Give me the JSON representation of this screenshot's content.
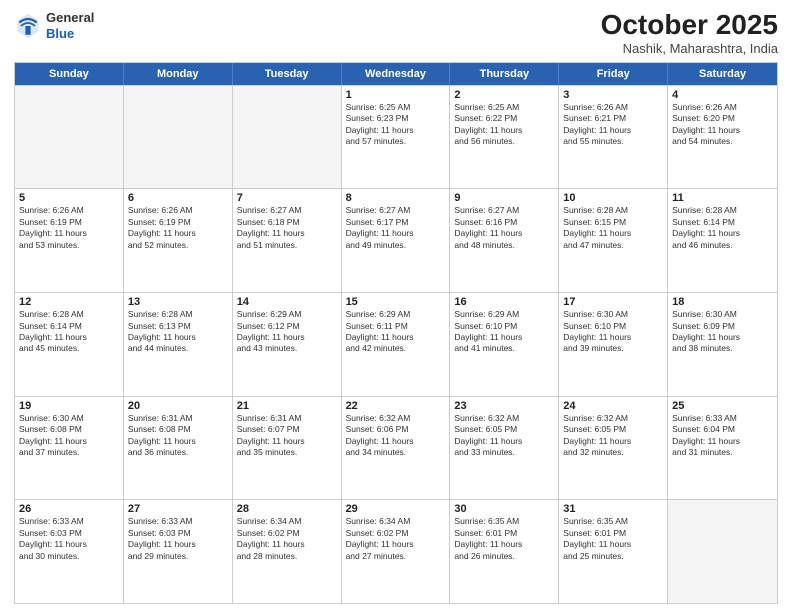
{
  "header": {
    "logo_line1": "General",
    "logo_line2": "Blue",
    "month_title": "October 2025",
    "location": "Nashik, Maharashtra, India"
  },
  "weekdays": [
    "Sunday",
    "Monday",
    "Tuesday",
    "Wednesday",
    "Thursday",
    "Friday",
    "Saturday"
  ],
  "rows": [
    [
      {
        "day": "",
        "info": ""
      },
      {
        "day": "",
        "info": ""
      },
      {
        "day": "",
        "info": ""
      },
      {
        "day": "1",
        "info": "Sunrise: 6:25 AM\nSunset: 6:23 PM\nDaylight: 11 hours\nand 57 minutes."
      },
      {
        "day": "2",
        "info": "Sunrise: 6:25 AM\nSunset: 6:22 PM\nDaylight: 11 hours\nand 56 minutes."
      },
      {
        "day": "3",
        "info": "Sunrise: 6:26 AM\nSunset: 6:21 PM\nDaylight: 11 hours\nand 55 minutes."
      },
      {
        "day": "4",
        "info": "Sunrise: 6:26 AM\nSunset: 6:20 PM\nDaylight: 11 hours\nand 54 minutes."
      }
    ],
    [
      {
        "day": "5",
        "info": "Sunrise: 6:26 AM\nSunset: 6:19 PM\nDaylight: 11 hours\nand 53 minutes."
      },
      {
        "day": "6",
        "info": "Sunrise: 6:26 AM\nSunset: 6:19 PM\nDaylight: 11 hours\nand 52 minutes."
      },
      {
        "day": "7",
        "info": "Sunrise: 6:27 AM\nSunset: 6:18 PM\nDaylight: 11 hours\nand 51 minutes."
      },
      {
        "day": "8",
        "info": "Sunrise: 6:27 AM\nSunset: 6:17 PM\nDaylight: 11 hours\nand 49 minutes."
      },
      {
        "day": "9",
        "info": "Sunrise: 6:27 AM\nSunset: 6:16 PM\nDaylight: 11 hours\nand 48 minutes."
      },
      {
        "day": "10",
        "info": "Sunrise: 6:28 AM\nSunset: 6:15 PM\nDaylight: 11 hours\nand 47 minutes."
      },
      {
        "day": "11",
        "info": "Sunrise: 6:28 AM\nSunset: 6:14 PM\nDaylight: 11 hours\nand 46 minutes."
      }
    ],
    [
      {
        "day": "12",
        "info": "Sunrise: 6:28 AM\nSunset: 6:14 PM\nDaylight: 11 hours\nand 45 minutes."
      },
      {
        "day": "13",
        "info": "Sunrise: 6:28 AM\nSunset: 6:13 PM\nDaylight: 11 hours\nand 44 minutes."
      },
      {
        "day": "14",
        "info": "Sunrise: 6:29 AM\nSunset: 6:12 PM\nDaylight: 11 hours\nand 43 minutes."
      },
      {
        "day": "15",
        "info": "Sunrise: 6:29 AM\nSunset: 6:11 PM\nDaylight: 11 hours\nand 42 minutes."
      },
      {
        "day": "16",
        "info": "Sunrise: 6:29 AM\nSunset: 6:10 PM\nDaylight: 11 hours\nand 41 minutes."
      },
      {
        "day": "17",
        "info": "Sunrise: 6:30 AM\nSunset: 6:10 PM\nDaylight: 11 hours\nand 39 minutes."
      },
      {
        "day": "18",
        "info": "Sunrise: 6:30 AM\nSunset: 6:09 PM\nDaylight: 11 hours\nand 38 minutes."
      }
    ],
    [
      {
        "day": "19",
        "info": "Sunrise: 6:30 AM\nSunset: 6:08 PM\nDaylight: 11 hours\nand 37 minutes."
      },
      {
        "day": "20",
        "info": "Sunrise: 6:31 AM\nSunset: 6:08 PM\nDaylight: 11 hours\nand 36 minutes."
      },
      {
        "day": "21",
        "info": "Sunrise: 6:31 AM\nSunset: 6:07 PM\nDaylight: 11 hours\nand 35 minutes."
      },
      {
        "day": "22",
        "info": "Sunrise: 6:32 AM\nSunset: 6:06 PM\nDaylight: 11 hours\nand 34 minutes."
      },
      {
        "day": "23",
        "info": "Sunrise: 6:32 AM\nSunset: 6:05 PM\nDaylight: 11 hours\nand 33 minutes."
      },
      {
        "day": "24",
        "info": "Sunrise: 6:32 AM\nSunset: 6:05 PM\nDaylight: 11 hours\nand 32 minutes."
      },
      {
        "day": "25",
        "info": "Sunrise: 6:33 AM\nSunset: 6:04 PM\nDaylight: 11 hours\nand 31 minutes."
      }
    ],
    [
      {
        "day": "26",
        "info": "Sunrise: 6:33 AM\nSunset: 6:03 PM\nDaylight: 11 hours\nand 30 minutes."
      },
      {
        "day": "27",
        "info": "Sunrise: 6:33 AM\nSunset: 6:03 PM\nDaylight: 11 hours\nand 29 minutes."
      },
      {
        "day": "28",
        "info": "Sunrise: 6:34 AM\nSunset: 6:02 PM\nDaylight: 11 hours\nand 28 minutes."
      },
      {
        "day": "29",
        "info": "Sunrise: 6:34 AM\nSunset: 6:02 PM\nDaylight: 11 hours\nand 27 minutes."
      },
      {
        "day": "30",
        "info": "Sunrise: 6:35 AM\nSunset: 6:01 PM\nDaylight: 11 hours\nand 26 minutes."
      },
      {
        "day": "31",
        "info": "Sunrise: 6:35 AM\nSunset: 6:01 PM\nDaylight: 11 hours\nand 25 minutes."
      },
      {
        "day": "",
        "info": ""
      }
    ]
  ]
}
